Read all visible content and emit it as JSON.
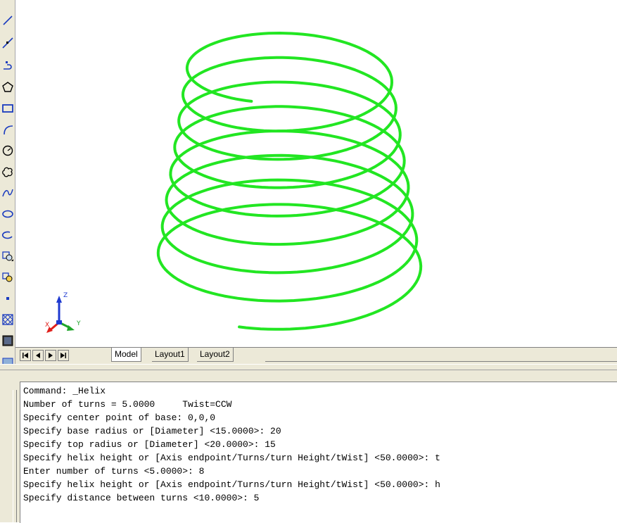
{
  "toolbar": {
    "tools": [
      {
        "icon": "line-icon"
      },
      {
        "icon": "construction-line-icon"
      },
      {
        "icon": "polyline-icon"
      },
      {
        "icon": "polygon-icon"
      },
      {
        "icon": "rectangle-icon"
      },
      {
        "icon": "arc-icon"
      },
      {
        "icon": "circle-icon"
      },
      {
        "icon": "revision-cloud-icon"
      },
      {
        "icon": "spline-icon"
      },
      {
        "icon": "ellipse-icon"
      },
      {
        "icon": "ellipse-arc-icon"
      },
      {
        "icon": "insert-block-icon"
      },
      {
        "icon": "make-block-icon"
      },
      {
        "icon": "point-icon"
      },
      {
        "icon": "hatch-icon"
      },
      {
        "icon": "gradient-icon"
      },
      {
        "icon": "region-icon"
      }
    ]
  },
  "viewport": {
    "helix_color": "#22e622",
    "ucs": {
      "x_label": "X",
      "y_label": "Y",
      "z_label": "Z"
    }
  },
  "tabs": {
    "nav_buttons": [
      "first-tab-icon",
      "prev-tab-icon",
      "next-tab-icon",
      "last-tab-icon"
    ],
    "items": [
      {
        "label": "Model",
        "active": true
      },
      {
        "label": "Layout1",
        "active": false
      },
      {
        "label": "Layout2",
        "active": false
      }
    ]
  },
  "command": {
    "lines": [
      "Command: _Helix",
      "Number of turns = 5.0000     Twist=CCW",
      "Specify center point of base: 0,0,0",
      "Specify base radius or [Diameter] <15.0000>: 20",
      "Specify top radius or [Diameter] <20.0000>: 15",
      "Specify helix height or [Axis endpoint/Turns/turn Height/tWist] <50.0000>: t",
      "Enter number of turns <5.0000>: 8",
      "Specify helix height or [Axis endpoint/Turns/turn Height/tWist] <50.0000>: h",
      "Specify distance between turns <10.0000>: 5"
    ]
  }
}
